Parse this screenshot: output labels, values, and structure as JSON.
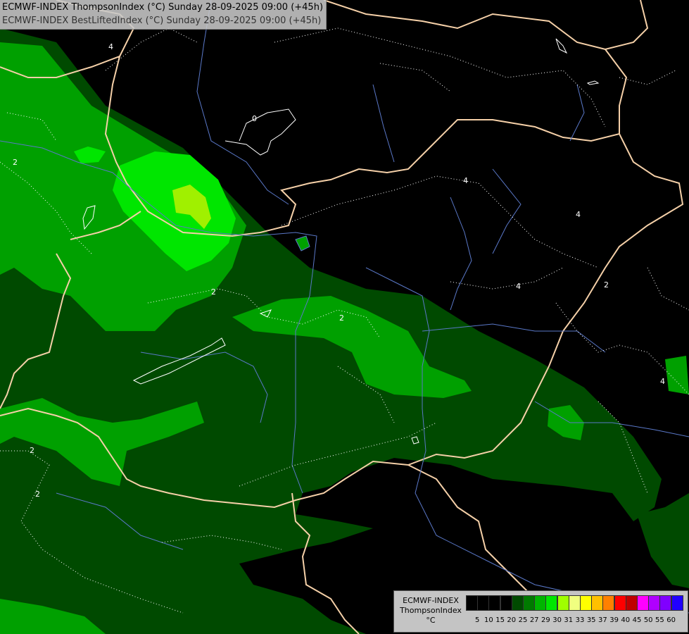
{
  "header": {
    "line1": "ECMWF-INDEX ThompsonIndex (°C) Sunday 28-09-2025 09:00 (+45h)",
    "line2": "ECMWF-INDEX BestLiftedIndex (°C) Sunday 28-09-2025 09:00 (+45h)"
  },
  "legend": {
    "title_lines": [
      "ECMWF-INDEX",
      "ThompsonIndex",
      "°C"
    ],
    "swatches": [
      {
        "color": "#000000"
      },
      {
        "color": "#000000"
      },
      {
        "color": "#000000"
      },
      {
        "color": "#000000"
      },
      {
        "color": "#004a00"
      },
      {
        "color": "#007a00"
      },
      {
        "color": "#00b400"
      },
      {
        "color": "#00e600"
      },
      {
        "color": "#a0ff00"
      },
      {
        "color": "#f0ff80"
      },
      {
        "color": "#ffff00"
      },
      {
        "color": "#ffc000"
      },
      {
        "color": "#ff8000"
      },
      {
        "color": "#ff0000"
      },
      {
        "color": "#c00000"
      },
      {
        "color": "#ff00ff"
      },
      {
        "color": "#b000ff"
      },
      {
        "color": "#8000ff"
      },
      {
        "color": "#2000ff"
      }
    ],
    "ticks": [
      "5",
      "10",
      "15",
      "20",
      "25",
      "27",
      "29",
      "30",
      "31",
      "33",
      "35",
      "37",
      "39",
      "40",
      "45",
      "50",
      "55",
      "60"
    ]
  },
  "contour_labels": [
    "2",
    "2",
    "2",
    "2",
    "2",
    "2",
    "4",
    "4",
    "4",
    "4",
    "4",
    "0"
  ]
}
